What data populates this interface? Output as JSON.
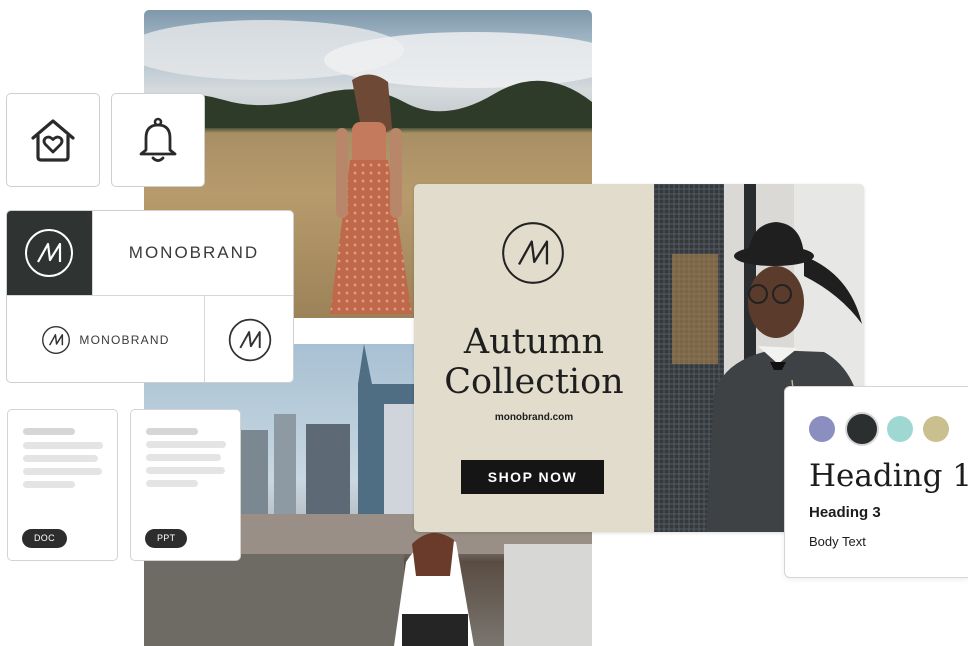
{
  "icons": {
    "home": "house-heart-icon",
    "bell": "bell-icon",
    "monogram": "m-monogram-icon"
  },
  "brand": {
    "wordmark_main": "MONOBRAND",
    "wordmark_small": "MONOBRAND",
    "monogram_letter": "M"
  },
  "files": [
    {
      "badge": "DOC"
    },
    {
      "badge": "PPT"
    }
  ],
  "ad": {
    "title_line1": "Autumn",
    "title_line2": "Collection",
    "url": "monobrand.com",
    "cta": "SHOP NOW",
    "background_color": "#e1dccb"
  },
  "style_guide": {
    "colors": [
      "#8b8fbf",
      "#2b2f2f",
      "#9fd8d3",
      "#c9bf8f"
    ],
    "heading1": "Heading 1",
    "heading3": "Heading 3",
    "body": "Body Text"
  }
}
